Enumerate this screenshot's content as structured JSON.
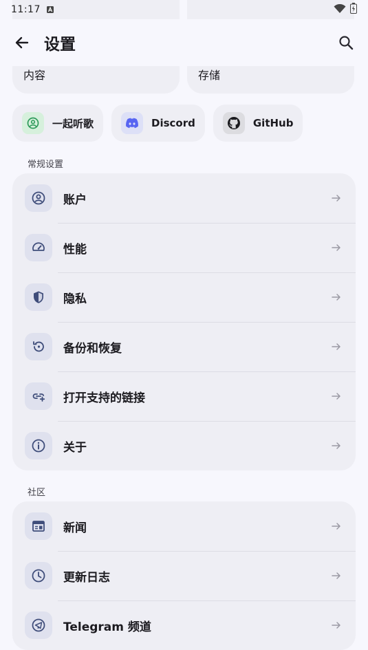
{
  "status_bar": {
    "time": "11:17"
  },
  "app_bar": {
    "title": "设置"
  },
  "top_cards": [
    {
      "label": "内容"
    },
    {
      "label": "存储"
    }
  ],
  "chips": [
    {
      "label": "一起听歌",
      "icon": "listen-together-icon",
      "bg": "#d6f0dc",
      "fg": "#2e9a5a"
    },
    {
      "label": "Discord",
      "icon": "discord-icon",
      "bg": "#dde0f7",
      "fg": "#5865f2"
    },
    {
      "label": "GitHub",
      "icon": "github-icon",
      "bg": "#dcdce0",
      "fg": "#1b1b1f"
    }
  ],
  "general": {
    "title": "常规设置",
    "items": [
      {
        "label": "账户",
        "icon": "account-icon"
      },
      {
        "label": "性能",
        "icon": "speedometer-icon"
      },
      {
        "label": "隐私",
        "icon": "shield-icon"
      },
      {
        "label": "备份和恢复",
        "icon": "restore-icon"
      },
      {
        "label": "打开支持的链接",
        "icon": "link-add-icon"
      },
      {
        "label": "关于",
        "icon": "info-icon"
      }
    ]
  },
  "community": {
    "title": "社区",
    "items": [
      {
        "label": "新闻",
        "icon": "news-icon"
      },
      {
        "label": "更新日志",
        "icon": "clock-icon"
      },
      {
        "label": "Telegram 频道",
        "icon": "telegram-icon"
      }
    ]
  },
  "colors": {
    "accent_icon": "#3f4d7a",
    "icon_bg": "#dfe1ee",
    "surface": "#eeeef4",
    "background": "#f7f7fd"
  }
}
